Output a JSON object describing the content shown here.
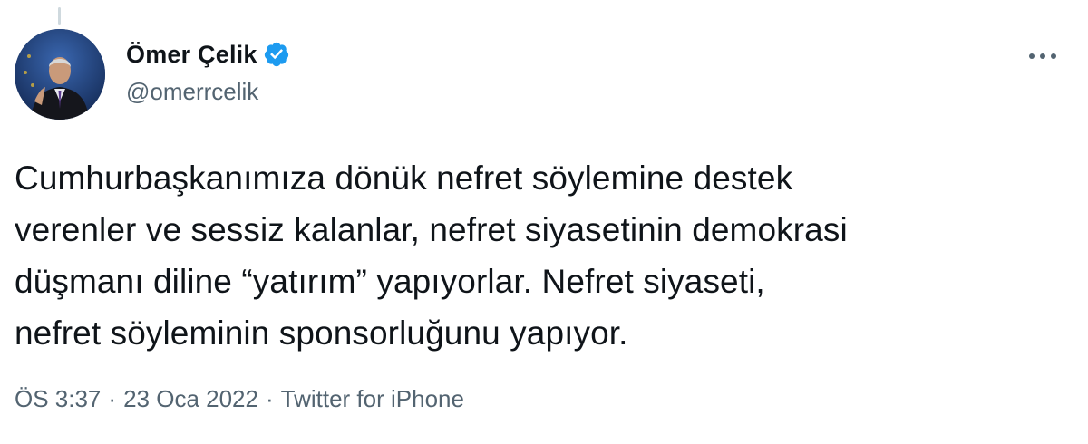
{
  "author": {
    "display_name": "Ömer Çelik",
    "handle": "@omerrcelik",
    "verified": true,
    "avatar_icon": "person-avatar"
  },
  "tweet": {
    "text": "Cumhurbaşkanımıza dönük nefret söylemine destek\nverenler ve sessiz kalanlar, nefret siyasetinin demokrasi\ndüşmanı diline “yatırım” yapıyorlar. Nefret siyaseti,\nnefret söyleminin sponsorluğunu yapıyor."
  },
  "meta": {
    "time": "ÖS 3:37",
    "date": "23 Oca 2022",
    "separator": "·",
    "source": "Twitter for iPhone"
  },
  "icons": {
    "verified": "verified-badge-icon",
    "more": "more-options-icon"
  },
  "colors": {
    "text_primary": "#0f1419",
    "text_secondary": "#536471",
    "verified_blue": "#1d9bf0",
    "thread_line": "#cfd9de"
  }
}
